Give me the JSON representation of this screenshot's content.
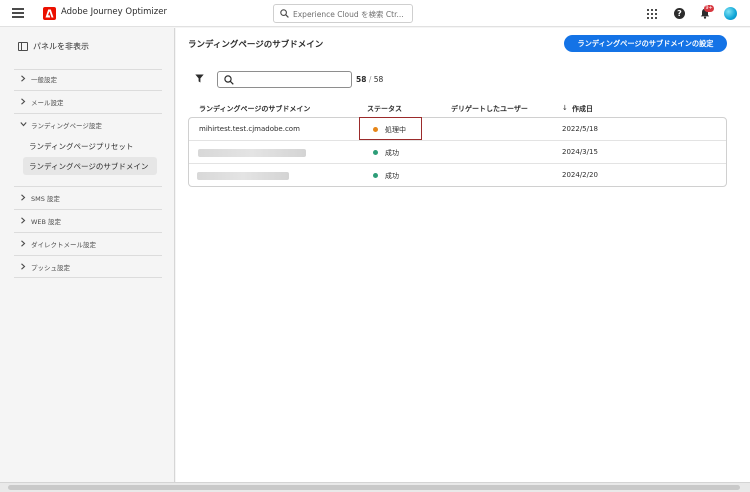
{
  "app": {
    "title": "Adobe Journey Optimizer",
    "notification_badge": "9+"
  },
  "search": {
    "placeholder": "Experience Cloud を検索 Ctr..."
  },
  "sidebar": {
    "hide_panel_label": "パネルを非表示",
    "items": [
      {
        "label": "一般設定",
        "expanded": false
      },
      {
        "label": "メール設定",
        "expanded": false
      },
      {
        "label": "ランディングページ設定",
        "expanded": true
      },
      {
        "label": "SMS 設定",
        "expanded": false
      },
      {
        "label": "WEB 設定",
        "expanded": false
      },
      {
        "label": "ダイレクトメール設定",
        "expanded": false
      },
      {
        "label": "プッシュ設定",
        "expanded": false
      }
    ],
    "sub_items": [
      {
        "label": "ランディングページプリセット",
        "selected": false
      },
      {
        "label": "ランディングページのサブドメイン",
        "selected": true
      }
    ]
  },
  "main": {
    "title": "ランディングページのサブドメイン",
    "cta_label": "ランディングページのサブドメインの設定",
    "count_shown": "58",
    "count_sep": "/",
    "count_total": "58",
    "columns": [
      "ランディングページのサブドメイン",
      "ステータス",
      "デリゲートしたユーザー",
      "作成日"
    ],
    "sort_indicator": "↓",
    "rows": [
      {
        "subdomain": "mihirtest.test.cjmadobe.com",
        "status": "処理中",
        "status_color": "#e68619",
        "delegated_user": "",
        "created": "2022/5/18",
        "redacted": false
      },
      {
        "subdomain": "",
        "status": "成功",
        "status_color": "#2d9d78",
        "delegated_user": "",
        "created": "2024/3/15",
        "redacted": true
      },
      {
        "subdomain": "",
        "status": "成功",
        "status_color": "#2d9d78",
        "delegated_user": "",
        "created": "2024/2/20",
        "redacted": true
      }
    ]
  },
  "colors": {
    "accent": "#1473e6",
    "brand_red": "#eb1000",
    "highlight_border": "#9b2b2b"
  }
}
